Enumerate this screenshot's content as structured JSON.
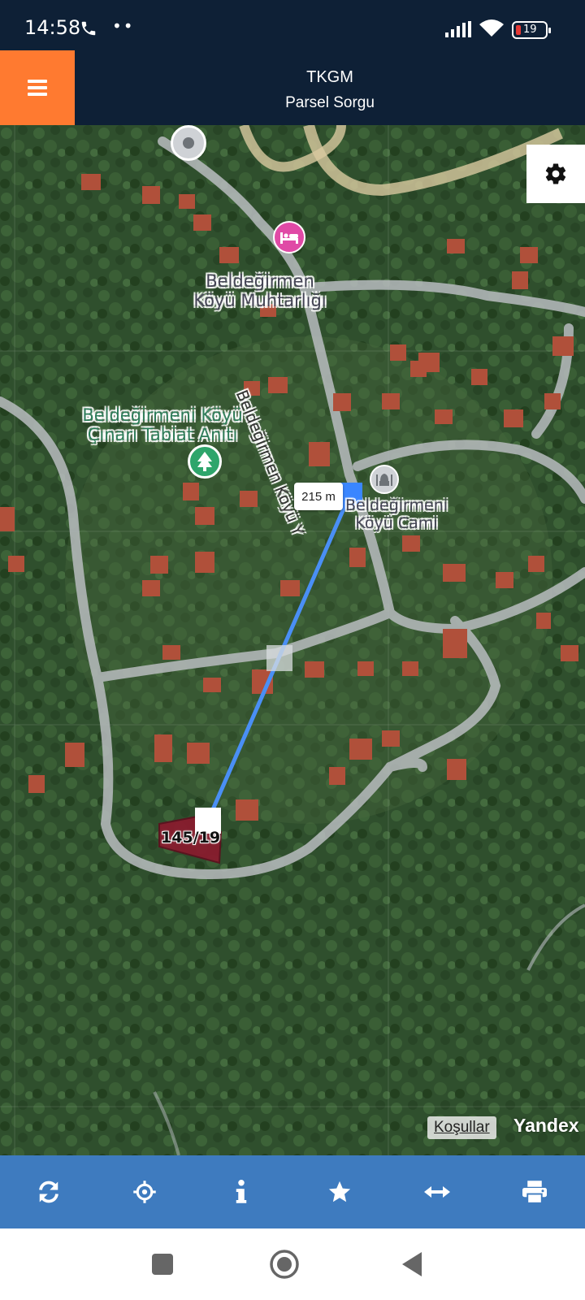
{
  "status_bar": {
    "time": "14:58",
    "battery_level": "19",
    "icons": [
      "phone-icon",
      "more-dots-icon",
      "signal-icon",
      "wifi-icon",
      "battery-icon"
    ]
  },
  "header": {
    "title": "TKGM",
    "subtitle": "Parsel Sorgu",
    "menu_icon": "hamburger-menu-icon",
    "accent_color": "#ff7a30",
    "background_color": "#0e2036"
  },
  "map": {
    "labels": {
      "muhtarlik": "Beldeğirmen\nKöyü Muhtarlığı",
      "tabiat": "Beldeğirmeni Köyü\nÇınarı Tabiat Anıtı",
      "cami": "Beldeğirmeni\nKöyü Cami",
      "road": "Beldeğirmen Köyü Y"
    },
    "measure": {
      "distance": "215 m",
      "line_color": "#4a8ff5"
    },
    "parcel": {
      "label": "145/19",
      "fill_color": "#8b1a2e"
    },
    "settings_icon": "gear-icon",
    "terms_link": "Koşullar",
    "provider": "Yandex"
  },
  "toolbar": {
    "background_color": "#3e7bbf",
    "buttons": [
      {
        "name": "refresh",
        "icon": "refresh-icon"
      },
      {
        "name": "locate",
        "icon": "crosshair-icon"
      },
      {
        "name": "info",
        "icon": "info-icon"
      },
      {
        "name": "favorite",
        "icon": "star-icon"
      },
      {
        "name": "measure",
        "icon": "arrows-horizontal-icon"
      },
      {
        "name": "print",
        "icon": "print-icon"
      }
    ]
  },
  "nav_bar": {
    "buttons": [
      "recents-square-icon",
      "home-circle-icon",
      "back-triangle-icon"
    ]
  }
}
